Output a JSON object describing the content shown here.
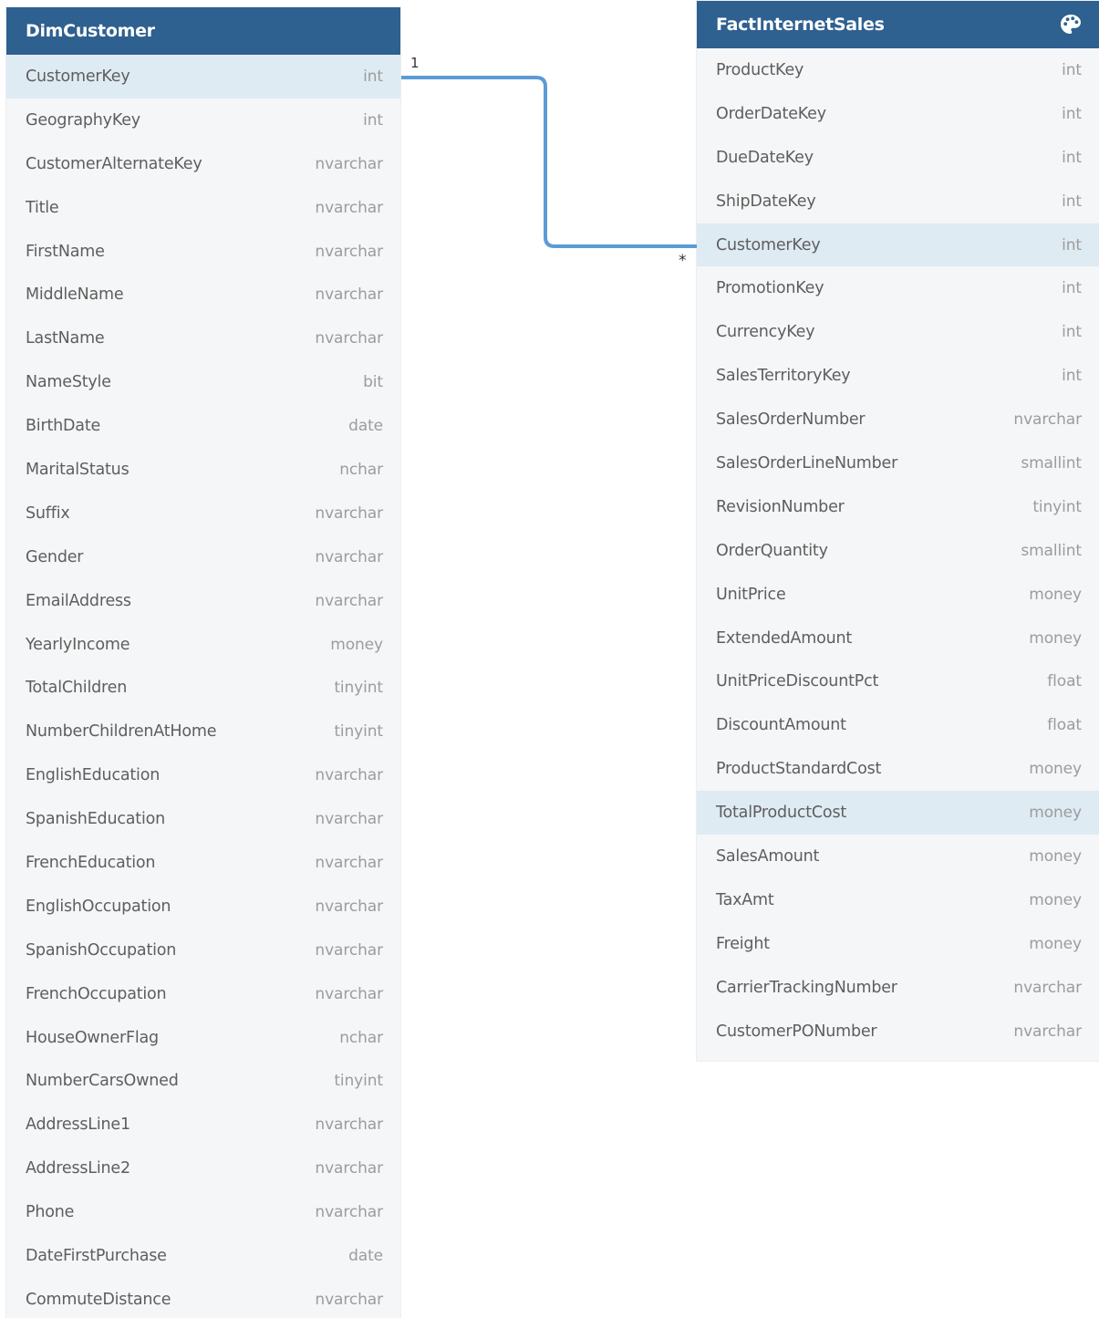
{
  "tables": [
    {
      "id": "dim",
      "name": "DimCustomer",
      "selected_column": "CustomerKey",
      "columns": [
        {
          "name": "CustomerKey",
          "type": "int"
        },
        {
          "name": "GeographyKey",
          "type": "int"
        },
        {
          "name": "CustomerAlternateKey",
          "type": "nvarchar"
        },
        {
          "name": "Title",
          "type": "nvarchar"
        },
        {
          "name": "FirstName",
          "type": "nvarchar"
        },
        {
          "name": "MiddleName",
          "type": "nvarchar"
        },
        {
          "name": "LastName",
          "type": "nvarchar"
        },
        {
          "name": "NameStyle",
          "type": "bit"
        },
        {
          "name": "BirthDate",
          "type": "date"
        },
        {
          "name": "MaritalStatus",
          "type": "nchar"
        },
        {
          "name": "Suffix",
          "type": "nvarchar"
        },
        {
          "name": "Gender",
          "type": "nvarchar"
        },
        {
          "name": "EmailAddress",
          "type": "nvarchar"
        },
        {
          "name": "YearlyIncome",
          "type": "money"
        },
        {
          "name": "TotalChildren",
          "type": "tinyint"
        },
        {
          "name": "NumberChildrenAtHome",
          "type": "tinyint"
        },
        {
          "name": "EnglishEducation",
          "type": "nvarchar"
        },
        {
          "name": "SpanishEducation",
          "type": "nvarchar"
        },
        {
          "name": "FrenchEducation",
          "type": "nvarchar"
        },
        {
          "name": "EnglishOccupation",
          "type": "nvarchar"
        },
        {
          "name": "SpanishOccupation",
          "type": "nvarchar"
        },
        {
          "name": "FrenchOccupation",
          "type": "nvarchar"
        },
        {
          "name": "HouseOwnerFlag",
          "type": "nchar"
        },
        {
          "name": "NumberCarsOwned",
          "type": "tinyint"
        },
        {
          "name": "AddressLine1",
          "type": "nvarchar"
        },
        {
          "name": "AddressLine2",
          "type": "nvarchar"
        },
        {
          "name": "Phone",
          "type": "nvarchar"
        },
        {
          "name": "DateFirstPurchase",
          "type": "date"
        },
        {
          "name": "CommuteDistance",
          "type": "nvarchar"
        }
      ]
    },
    {
      "id": "fact",
      "name": "FactInternetSales",
      "header_icon": "palette-icon",
      "selected_columns": [
        "CustomerKey",
        "TotalProductCost"
      ],
      "columns": [
        {
          "name": "ProductKey",
          "type": "int"
        },
        {
          "name": "OrderDateKey",
          "type": "int"
        },
        {
          "name": "DueDateKey",
          "type": "int"
        },
        {
          "name": "ShipDateKey",
          "type": "int"
        },
        {
          "name": "CustomerKey",
          "type": "int"
        },
        {
          "name": "PromotionKey",
          "type": "int"
        },
        {
          "name": "CurrencyKey",
          "type": "int"
        },
        {
          "name": "SalesTerritoryKey",
          "type": "int"
        },
        {
          "name": "SalesOrderNumber",
          "type": "nvarchar"
        },
        {
          "name": "SalesOrderLineNumber",
          "type": "smallint"
        },
        {
          "name": "RevisionNumber",
          "type": "tinyint"
        },
        {
          "name": "OrderQuantity",
          "type": "smallint"
        },
        {
          "name": "UnitPrice",
          "type": "money"
        },
        {
          "name": "ExtendedAmount",
          "type": "money"
        },
        {
          "name": "UnitPriceDiscountPct",
          "type": "float"
        },
        {
          "name": "DiscountAmount",
          "type": "float"
        },
        {
          "name": "ProductStandardCost",
          "type": "money"
        },
        {
          "name": "TotalProductCost",
          "type": "money"
        },
        {
          "name": "SalesAmount",
          "type": "money"
        },
        {
          "name": "TaxAmt",
          "type": "money"
        },
        {
          "name": "Freight",
          "type": "money"
        },
        {
          "name": "CarrierTrackingNumber",
          "type": "nvarchar"
        },
        {
          "name": "CustomerPONumber",
          "type": "nvarchar"
        }
      ]
    }
  ],
  "relationship": {
    "from": "DimCustomer.CustomerKey",
    "to": "FactInternetSales.CustomerKey",
    "from_cardinality": "1",
    "to_cardinality": "*",
    "line_color": "#5b9bd5"
  },
  "colors": {
    "header_bg": "#2e6090",
    "selected_row_bg": "#dfebf3",
    "table_bg": "#f5f6f7"
  }
}
